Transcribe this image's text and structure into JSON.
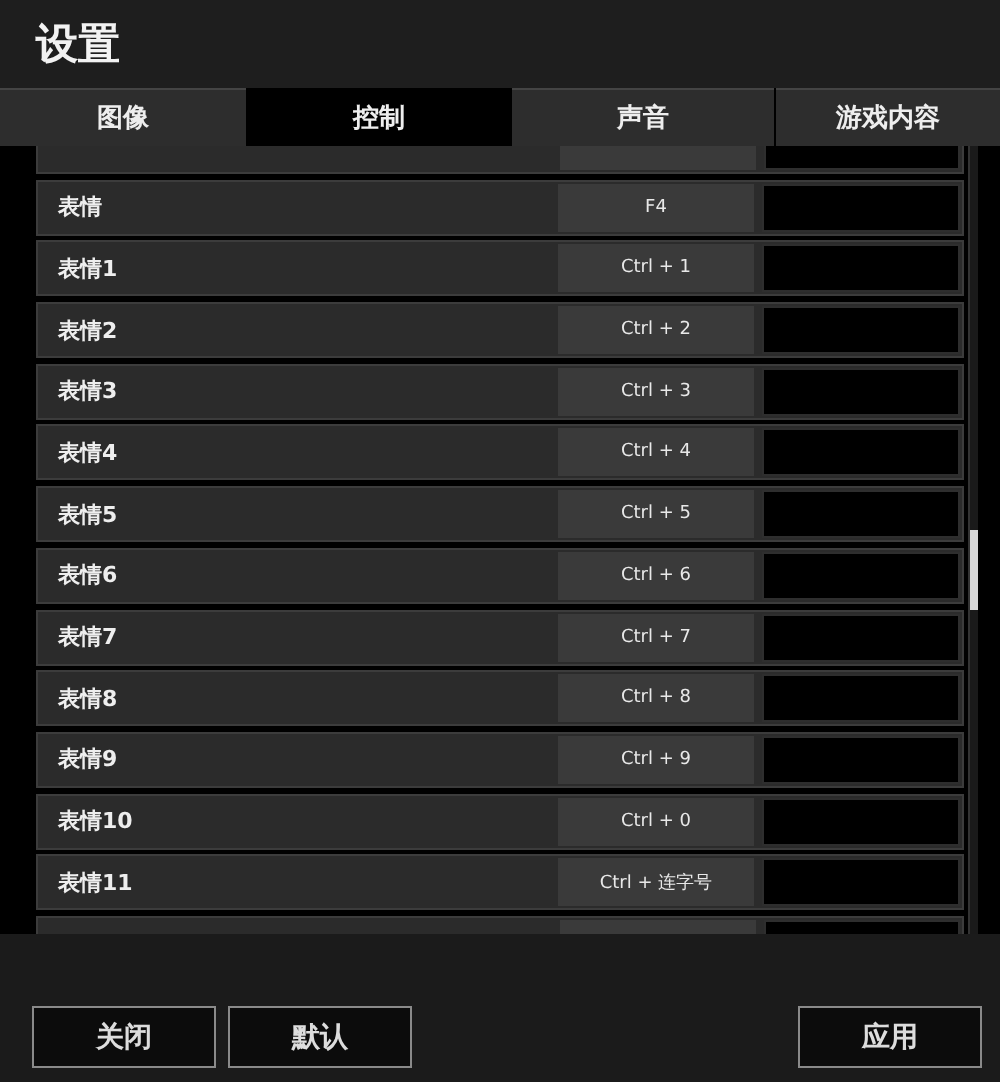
{
  "window": {
    "title": "设置"
  },
  "tabs": [
    {
      "label": "图像",
      "selected": false
    },
    {
      "label": "控制",
      "selected": true
    },
    {
      "label": "声音",
      "selected": false
    },
    {
      "label": "游戏内容",
      "selected": false
    }
  ],
  "rows": [
    {
      "label": "表情",
      "key": "F4"
    },
    {
      "label": "表情1",
      "key": "Ctrl + 1"
    },
    {
      "label": "表情2",
      "key": "Ctrl + 2"
    },
    {
      "label": "表情3",
      "key": "Ctrl + 3"
    },
    {
      "label": "表情4",
      "key": "Ctrl + 4"
    },
    {
      "label": "表情5",
      "key": "Ctrl + 5"
    },
    {
      "label": "表情6",
      "key": "Ctrl + 6"
    },
    {
      "label": "表情7",
      "key": "Ctrl + 7"
    },
    {
      "label": "表情8",
      "key": "Ctrl + 8"
    },
    {
      "label": "表情9",
      "key": "Ctrl + 9"
    },
    {
      "label": "表情10",
      "key": "Ctrl + 0"
    },
    {
      "label": "表情11",
      "key": "Ctrl + 连字号"
    }
  ],
  "buttons_left": [
    "关闭",
    "默认"
  ],
  "buttons_right": [
    "应用"
  ]
}
